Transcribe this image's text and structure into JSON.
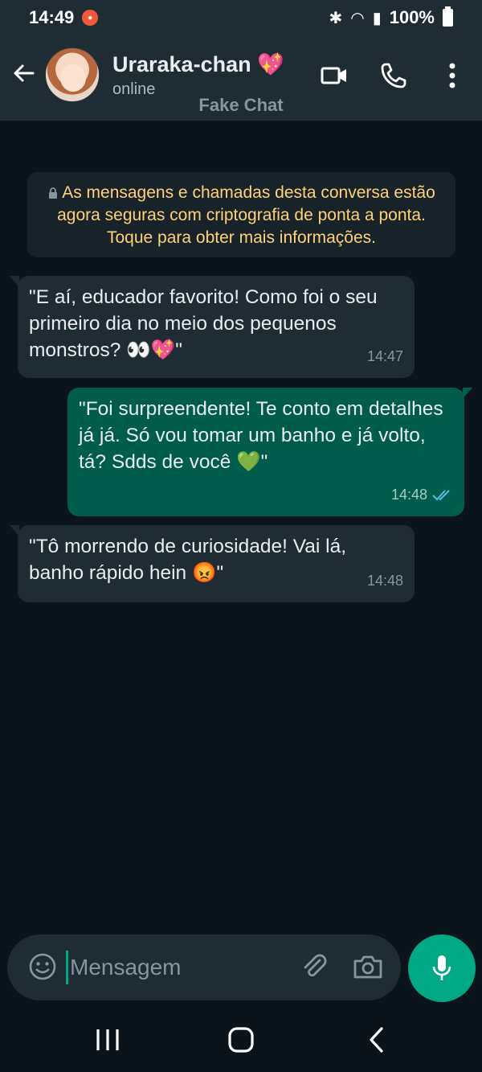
{
  "status_bar": {
    "time": "14:49",
    "battery": "100%"
  },
  "header": {
    "contact_name": "Uraraka-chan 💖",
    "contact_status": "online",
    "subtitle": "Fake Chat"
  },
  "chat": {
    "encryption_notice": "As mensagens e chamadas desta conversa estão agora seguras com criptografia de ponta a ponta. Toque para obter mais informações.",
    "messages": [
      {
        "direction": "in",
        "text": "\"E aí, educador favorito! Como foi o seu primeiro dia no meio dos pequenos monstros? 👀💖\"",
        "time": "14:47"
      },
      {
        "direction": "out",
        "text": "\"Foi surpreendente! Te conto em detalhes já já. Só vou tomar um banho e já volto, tá? Sdds de você 💚\"",
        "time": "14:48",
        "status": "read"
      },
      {
        "direction": "in",
        "text": "\"Tô morrendo de curiosidade! Vai lá, banho rápido hein 😡\"",
        "time": "14:48"
      }
    ]
  },
  "composer": {
    "placeholder": "Mensagem"
  },
  "colors": {
    "background": "#0b141a",
    "header": "#1f2c34",
    "incoming_bubble": "#202c33",
    "outgoing_bubble": "#005c4b",
    "accent": "#00a884",
    "encryption_text": "#ffd279",
    "read_ticks": "#53bdeb"
  },
  "icons": [
    "back-arrow-icon",
    "video-call-icon",
    "voice-call-icon",
    "more-options-icon",
    "lock-icon",
    "emoji-icon",
    "attach-icon",
    "camera-icon",
    "mic-icon",
    "read-ticks-icon"
  ]
}
